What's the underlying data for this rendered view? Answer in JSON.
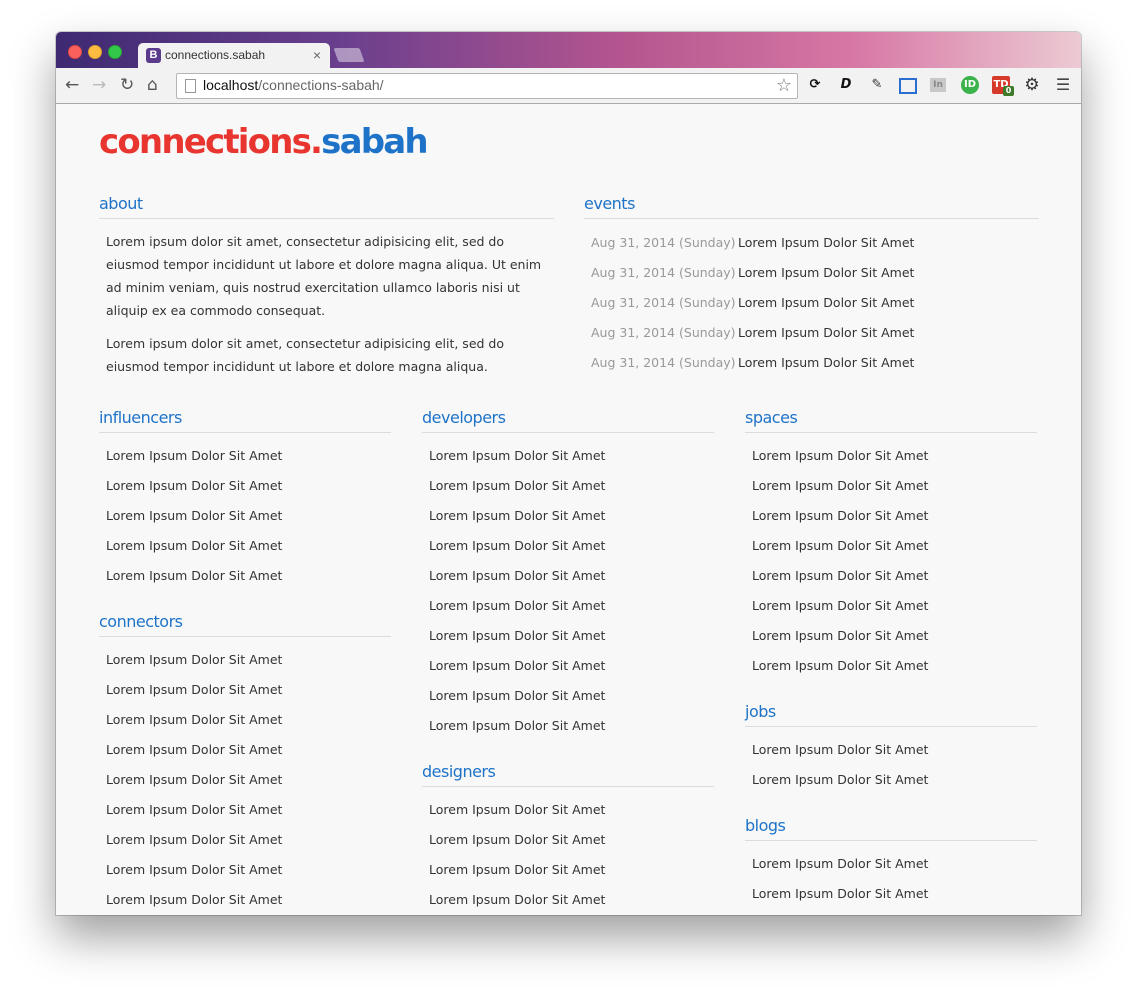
{
  "browser": {
    "tab_title": "connections.sabah",
    "tab_favicon": "B",
    "tab_close": "×",
    "url_host": "localhost",
    "url_path": "/connections-sabah/",
    "icons": {
      "back": "back-arrow-icon",
      "forward": "forward-arrow-icon",
      "reload": "reload-icon",
      "home": "home-icon",
      "bookmark": "star-icon",
      "menu": "hamburger-menu-icon"
    },
    "extensions": {
      "td_badge": "0"
    }
  },
  "site": {
    "logo_part1": "connections",
    "logo_dot": ".",
    "logo_part2": "sabah",
    "brand_red": "#e8352f",
    "brand_blue": "#1e73c8"
  },
  "about": {
    "heading": "about",
    "paragraphs": [
      "Lorem ipsum dolor sit amet, consectetur adipisicing elit, sed do eiusmod tempor incididunt ut labore et dolore magna aliqua. Ut enim ad minim veniam, quis nostrud exercitation ullamco laboris nisi ut aliquip ex ea commodo consequat.",
      "Lorem ipsum dolor sit amet, consectetur adipisicing elit, sed do eiusmod tempor incididunt ut labore et dolore magna aliqua."
    ]
  },
  "events": {
    "heading": "events",
    "items": [
      {
        "date": "Aug 31, 2014 (Sunday)",
        "title": "Lorem Ipsum Dolor Sit Amet"
      },
      {
        "date": "Aug 31, 2014 (Sunday)",
        "title": "Lorem Ipsum Dolor Sit Amet"
      },
      {
        "date": "Aug 31, 2014 (Sunday)",
        "title": "Lorem Ipsum Dolor Sit Amet"
      },
      {
        "date": "Aug 31, 2014 (Sunday)",
        "title": "Lorem Ipsum Dolor Sit Amet"
      },
      {
        "date": "Aug 31, 2014 (Sunday)",
        "title": "Lorem Ipsum Dolor Sit Amet"
      }
    ]
  },
  "influencers": {
    "heading": "influencers",
    "items": [
      "Lorem Ipsum Dolor Sit Amet",
      "Lorem Ipsum Dolor Sit Amet",
      "Lorem Ipsum Dolor Sit Amet",
      "Lorem Ipsum Dolor Sit Amet",
      "Lorem Ipsum Dolor Sit Amet"
    ]
  },
  "connectors": {
    "heading": "connectors",
    "items": [
      "Lorem Ipsum Dolor Sit Amet",
      "Lorem Ipsum Dolor Sit Amet",
      "Lorem Ipsum Dolor Sit Amet",
      "Lorem Ipsum Dolor Sit Amet",
      "Lorem Ipsum Dolor Sit Amet",
      "Lorem Ipsum Dolor Sit Amet",
      "Lorem Ipsum Dolor Sit Amet",
      "Lorem Ipsum Dolor Sit Amet",
      "Lorem Ipsum Dolor Sit Amet"
    ]
  },
  "developers": {
    "heading": "developers",
    "items": [
      "Lorem Ipsum Dolor Sit Amet",
      "Lorem Ipsum Dolor Sit Amet",
      "Lorem Ipsum Dolor Sit Amet",
      "Lorem Ipsum Dolor Sit Amet",
      "Lorem Ipsum Dolor Sit Amet",
      "Lorem Ipsum Dolor Sit Amet",
      "Lorem Ipsum Dolor Sit Amet",
      "Lorem Ipsum Dolor Sit Amet",
      "Lorem Ipsum Dolor Sit Amet",
      "Lorem Ipsum Dolor Sit Amet"
    ]
  },
  "designers": {
    "heading": "designers",
    "items": [
      "Lorem Ipsum Dolor Sit Amet",
      "Lorem Ipsum Dolor Sit Amet",
      "Lorem Ipsum Dolor Sit Amet",
      "Lorem Ipsum Dolor Sit Amet"
    ]
  },
  "spaces": {
    "heading": "spaces",
    "items": [
      "Lorem Ipsum Dolor Sit Amet",
      "Lorem Ipsum Dolor Sit Amet",
      "Lorem Ipsum Dolor Sit Amet",
      "Lorem Ipsum Dolor Sit Amet",
      "Lorem Ipsum Dolor Sit Amet",
      "Lorem Ipsum Dolor Sit Amet",
      "Lorem Ipsum Dolor Sit Amet",
      "Lorem Ipsum Dolor Sit Amet"
    ]
  },
  "jobs": {
    "heading": "jobs",
    "items": [
      "Lorem Ipsum Dolor Sit Amet",
      "Lorem Ipsum Dolor Sit Amet"
    ]
  },
  "blogs": {
    "heading": "blogs",
    "items": [
      "Lorem Ipsum Dolor Sit Amet",
      "Lorem Ipsum Dolor Sit Amet"
    ]
  }
}
